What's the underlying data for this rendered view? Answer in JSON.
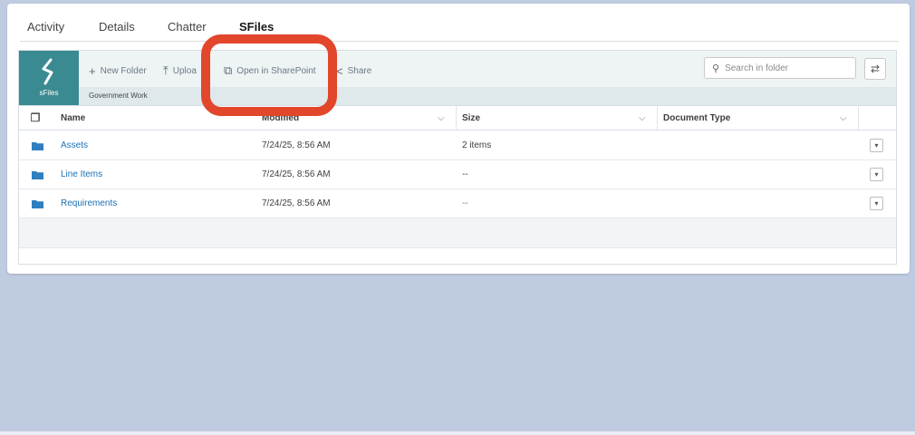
{
  "tabs": [
    "Activity",
    "Details",
    "Chatter",
    "SFiles"
  ],
  "active_tab": "SFiles",
  "app": {
    "logo_label": "sFiles"
  },
  "toolbar": {
    "new_folder": "New Folder",
    "upload": "Uploa",
    "open_in_sharepoint": "Open in SharePoint",
    "share": "Share",
    "breadcrumb": "Government Work",
    "search_placeholder": "Search in folder"
  },
  "table": {
    "columns": [
      "Name",
      "Modified",
      "Size",
      "Document Type"
    ],
    "rows": [
      {
        "name": "Assets",
        "modified": "7/24/25, 8:56 AM",
        "size": "2 items",
        "doc_type": ""
      },
      {
        "name": "Line Items",
        "modified": "7/24/25, 8:56 AM",
        "size": "--",
        "doc_type": ""
      },
      {
        "name": "Requirements",
        "modified": "7/24/25, 8:56 AM",
        "size": "--",
        "doc_type": ""
      }
    ]
  },
  "colors": {
    "brand_teal": "#3a8a91",
    "link_blue": "#1b6fb5",
    "highlight_red": "#e2462b",
    "page_background": "#bfcbe0"
  },
  "icons": {
    "logo": "sfiles-logo-icon",
    "new_folder": "plus-icon",
    "upload": "upload-icon",
    "open_in_sharepoint": "external-link-icon",
    "share": "share-icon",
    "search": "search-icon",
    "refresh": "refresh-icon",
    "select_all": "copy-icon",
    "row_folder": "folder-icon",
    "row_menu": "chevron-down-icon"
  }
}
